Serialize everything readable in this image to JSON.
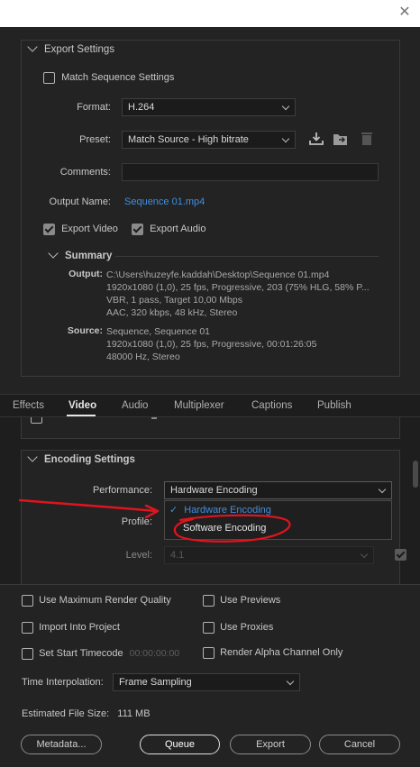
{
  "window": {
    "close_icon": "close-icon"
  },
  "export_settings": {
    "header": "Export Settings",
    "match_sequence_label": "Match Sequence Settings",
    "format_label": "Format:",
    "format_value": "H.264",
    "preset_label": "Preset:",
    "preset_value": "Match Source - High bitrate",
    "comments_label": "Comments:",
    "output_name_label": "Output Name:",
    "output_name_value": "Sequence 01.mp4",
    "export_video_label": "Export Video",
    "export_audio_label": "Export Audio",
    "summary": {
      "header": "Summary",
      "output_key": "Output:",
      "output_lines": [
        "C:\\Users\\huzeyfe.kaddah\\Desktop\\Sequence 01.mp4",
        "1920x1080 (1,0), 25 fps, Progressive, 203 (75% HLG, 58% P...",
        "VBR, 1 pass, Target 10,00 Mbps",
        "AAC, 320 kbps, 48 kHz, Stereo"
      ],
      "source_key": "Source:",
      "source_lines": [
        "Sequence, Sequence 01",
        "1920x1080 (1,0), 25 fps, Progressive, 00:01:26:05",
        "48000 Hz, Stereo"
      ]
    }
  },
  "tabs": [
    "Effects",
    "Video",
    "Audio",
    "Multiplexer",
    "Captions",
    "Publish"
  ],
  "active_tab": "Video",
  "encoding": {
    "header": "Encoding Settings",
    "performance_label": "Performance:",
    "performance_value": "Hardware Encoding",
    "options": [
      "Hardware Encoding",
      "Software Encoding"
    ],
    "profile_label": "Profile:",
    "level_label": "Level:",
    "level_value": "4.1"
  },
  "bottom": {
    "max_render_quality": "Use Maximum Render Quality",
    "use_previews": "Use Previews",
    "import_into_project": "Import Into Project",
    "use_proxies": "Use Proxies",
    "set_start_timecode": "Set Start Timecode",
    "start_timecode_value": "00:00:00:00",
    "render_alpha": "Render Alpha Channel Only",
    "time_interp_label": "Time Interpolation:",
    "time_interp_value": "Frame Sampling",
    "file_size_label": "Estimated File Size:",
    "file_size_value": "111 MB",
    "metadata_btn": "Metadata...",
    "queue_btn": "Queue",
    "export_btn": "Export",
    "cancel_btn": "Cancel"
  },
  "colors": {
    "accent": "#3f8fe0",
    "annotation": "#e0141e"
  }
}
